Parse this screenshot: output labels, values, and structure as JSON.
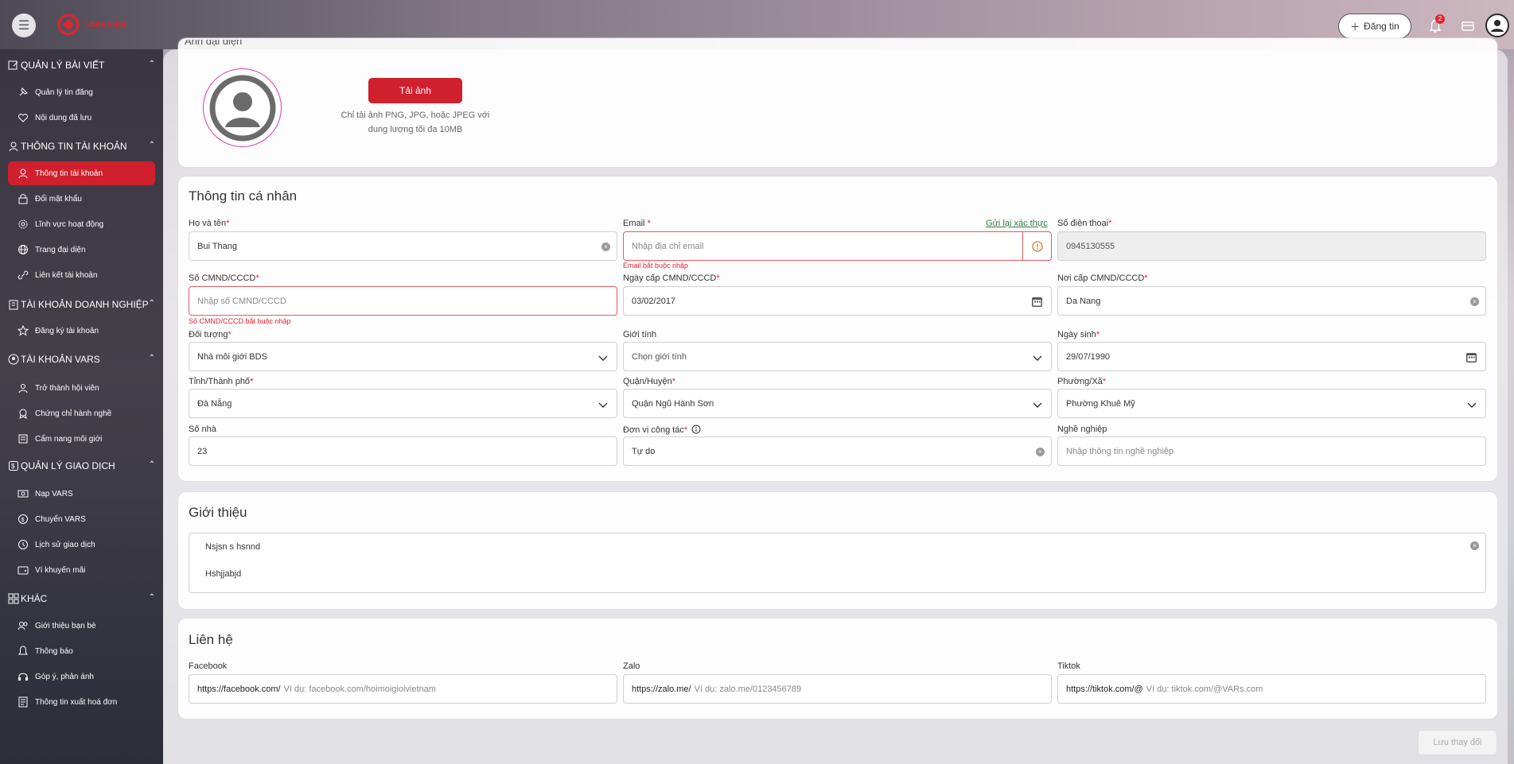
{
  "topbar": {
    "logo_text": "VARS CHAT",
    "post_button": "Đăng tin",
    "notification_count": "2"
  },
  "sidebar": {
    "groups": [
      {
        "label": "QUẢN LÝ BÀI VIẾT",
        "items": [
          "Quản lý tin đăng",
          "Nội dung đã lưu"
        ]
      },
      {
        "label": "THÔNG TIN TÀI KHOẢN",
        "items": [
          "Thông tin tài khoản",
          "Đổi mật khẩu",
          "Lĩnh vực hoạt động",
          "Trang đại diện",
          "Liên kết tài khoản"
        ]
      },
      {
        "label": "TÀI KHOẢN DOANH NGHIỆP",
        "items": [
          "Đăng ký tài khoản"
        ]
      },
      {
        "label": "TÀI KHOẢN VARS",
        "items": [
          "Trở thành hội viên",
          "Chứng chỉ hành nghề",
          "Cẩm nang môi giới"
        ]
      },
      {
        "label": "QUẢN LÝ GIAO DỊCH",
        "items": [
          "Nạp VARS",
          "Chuyển VARS",
          "Lịch sử giao dịch",
          "Ví khuyến mãi"
        ]
      },
      {
        "label": "KHÁC",
        "items": [
          "Giới thiệu bạn bè",
          "Thông báo",
          "Góp ý, phản ánh",
          "Thông tin xuất hoá đơn"
        ]
      }
    ],
    "active_item": "Thông tin tài khoản"
  },
  "avatar_section": {
    "title": "Ảnh đại diện",
    "upload_button": "Tải ảnh",
    "hint_line1": "Chỉ tải ảnh PNG, JPG, hoặc JPEG với",
    "hint_line2": "dung lượng tối đa 10MB"
  },
  "personal": {
    "title": "Thông tin cá nhân",
    "full_name": {
      "label": "Họ và tên",
      "value": "Bui Thang"
    },
    "email": {
      "label": "Email",
      "placeholder": "Nhập địa chỉ email",
      "error": "Email bắt buộc nhập",
      "resend_link": "Gửi lại xác thực"
    },
    "phone": {
      "label": "Số điện thoại",
      "value": "0945130555"
    },
    "id_number": {
      "label": "Số CMND/CCCD",
      "placeholder": "Nhập số CMND/CCCD",
      "error": "Số CMND/CCCD bắt buộc nhập"
    },
    "id_date": {
      "label": "Ngày cấp CMND/CCCD",
      "value": "03/02/2017"
    },
    "id_place": {
      "label": "Nơi cấp CMND/CCCD",
      "value": "Da Nang"
    },
    "audience": {
      "label": "Đối tượng",
      "value": "Nhà môi giới BDS"
    },
    "gender": {
      "label": "Giới tính",
      "placeholder": "Chọn giới tính"
    },
    "birthday": {
      "label": "Ngày sinh",
      "value": "29/07/1990"
    },
    "province": {
      "label": "Tỉnh/Thành phố",
      "value": "Đà Nẵng"
    },
    "district": {
      "label": "Quận/Huyện",
      "value": "Quận Ngũ Hành Sơn"
    },
    "ward": {
      "label": "Phường/Xã",
      "value": "Phường Khuê Mỹ"
    },
    "house_no": {
      "label": "Số nhà",
      "value": "23"
    },
    "workplace": {
      "label": "Đơn vị công tác",
      "value": "Tự do"
    },
    "occupation": {
      "label": "Nghề nghiệp",
      "placeholder": "Nhập thông tin nghề nghiệp"
    }
  },
  "intro": {
    "title": "Giới thiệu",
    "line1": "Nsjsn s hsnnd",
    "line2": "Hshjjabjd"
  },
  "contact": {
    "title": "Liên hệ",
    "facebook": {
      "label": "Facebook",
      "prefix": "https://facebook.com/",
      "placeholder": "Ví dụ: facebook.com/hoimoigioivietnam"
    },
    "zalo": {
      "label": "Zalo",
      "prefix": "https://zalo.me/",
      "placeholder": "Ví dụ: zalo.me/0123456789"
    },
    "tiktok": {
      "label": "Tiktok",
      "prefix": "https://tiktok.com/@",
      "placeholder": "Ví dụ: tiktok.com/@VARs.com"
    }
  },
  "save_button": "Lưu thay đổi",
  "colors": {
    "accent": "#d0202d",
    "error": "#e2242f",
    "link": "#2f7d3f"
  }
}
